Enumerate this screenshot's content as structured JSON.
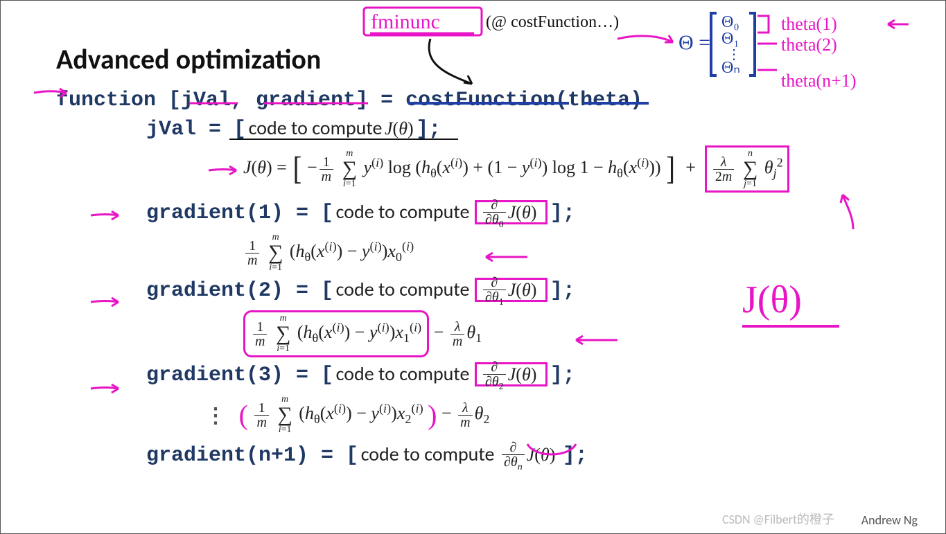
{
  "title": "Advanced optimization",
  "author": "Andrew Ng",
  "watermark": "CSDN @Filbert的橙子",
  "code": {
    "fn_decl": "function [jVal, gradient] = costFunction(theta)",
    "jval": "jVal  = [",
    "code_to_compute": "code to compute",
    "grad1": "gradient(1)  = [",
    "grad2": "gradient(2)  = [",
    "grad3": "gradient(3)  = [",
    "gradn1": "gradient(n+1)  = [",
    "dots": "⋮",
    "end_bracket": "];",
    "end_bracket_sp": " ];"
  },
  "math": {
    "Jtheta": "J(θ)",
    "partial0": "∂/∂θ₀ J(θ)",
    "partial1": "∂/∂θ₁ J(θ)",
    "partial2": "∂/∂θ₂ J(θ)",
    "partialn": "∂/∂θₙ J(θ)",
    "cost_formula_main": "−(1/m) Σᵢ₌₁ᵐ y⁽ⁱ⁾ log(h_θ(x⁽ⁱ⁾)) + (1 − y⁽ⁱ⁾) log(1 − h_θ(x⁽ⁱ⁾))",
    "regularization": "(λ / 2m) Σⱼ₌₁ⁿ θⱼ²",
    "grad0_formula": "(1/m) Σᵢ₌₁ᵐ (h_θ(x⁽ⁱ⁾) − y⁽ⁱ⁾) x₀⁽ⁱ⁾",
    "grad1_formula": "(1/m) Σᵢ₌₁ᵐ (h_θ(x⁽ⁱ⁾) − y⁽ⁱ⁾) x₁⁽ⁱ⁾ − (λ/m) θ₁",
    "grad2_formula": "(1/m) Σᵢ₌₁ᵐ (h_θ(x⁽ⁱ⁾) − y⁽ⁱ⁾) x₂⁽ⁱ⁾ − (λ/m) θ₂"
  },
  "handwritten": {
    "fminunc": "fminunc",
    "atcost": "(@ costFunction…)",
    "theta_eq": "Θ =",
    "theta0": "Θ₀",
    "theta1": "Θ₁",
    "thetadots": "⋮",
    "thetan": "Θₙ",
    "theta_idx1": "theta(1)",
    "theta_idx2": "theta(2)",
    "theta_idxn1": "theta(n+1)",
    "Jtheta_big": "J(θ)"
  }
}
